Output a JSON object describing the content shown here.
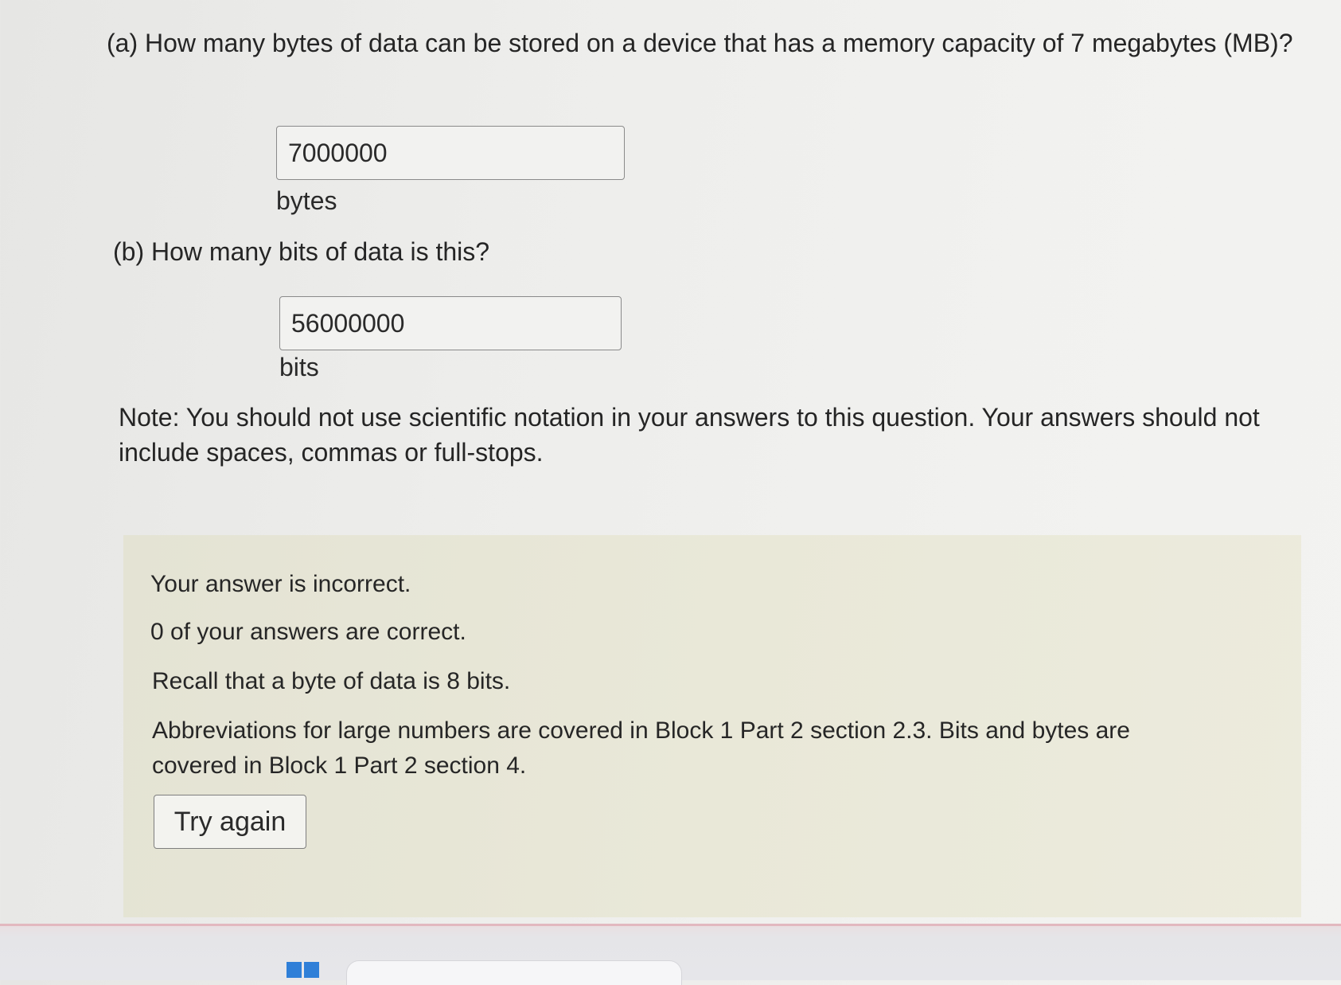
{
  "question_a": {
    "text": "(a) How many bytes of data can be stored on a device that has a memory capacity of 7 megabytes (MB)?",
    "answer_value": "7000000",
    "unit": "bytes"
  },
  "question_b": {
    "text": "(b) How many bits of data is this?",
    "answer_value": "56000000",
    "unit": "bits"
  },
  "note": "Note: You should not use scientific notation in your answers to this question. Your answers should not include spaces, commas or full-stops.",
  "feedback": {
    "status": "Your answer is incorrect.",
    "score": "0 of your answers are correct.",
    "hint": "Recall that a byte of data is 8 bits.",
    "reference": "Abbreviations for large numbers are covered in Block 1 Part 2 section 2.3. Bits and bytes are covered in Block 1 Part 2 section 4.",
    "try_again_label": "Try again"
  },
  "colors": {
    "feedback_background": "#e9e8d8",
    "taskbar_accent": "#2f7fd8"
  }
}
